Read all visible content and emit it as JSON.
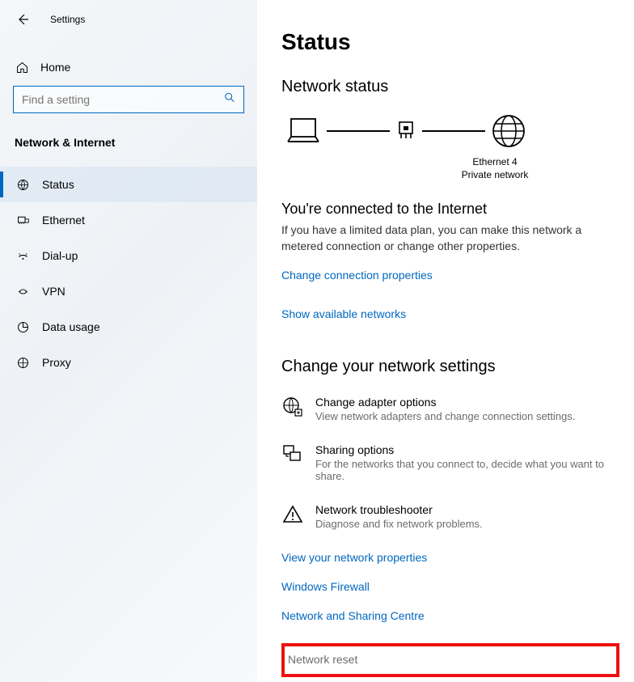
{
  "app": {
    "title": "Settings"
  },
  "home": {
    "label": "Home"
  },
  "search": {
    "placeholder": "Find a setting"
  },
  "category": {
    "title": "Network & Internet"
  },
  "nav": {
    "items": [
      {
        "label": "Status",
        "selected": true
      },
      {
        "label": "Ethernet",
        "selected": false
      },
      {
        "label": "Dial-up",
        "selected": false
      },
      {
        "label": "VPN",
        "selected": false
      },
      {
        "label": "Data usage",
        "selected": false
      },
      {
        "label": "Proxy",
        "selected": false
      }
    ]
  },
  "main": {
    "title": "Status",
    "network_status_heading": "Network status",
    "diagram": {
      "adapter_name": "Ethernet 4",
      "profile": "Private network"
    },
    "connected_title": "You're connected to the Internet",
    "connected_body": "If you have a limited data plan, you can make this network a metered connection or change other properties.",
    "link_change_conn": "Change connection properties",
    "link_show_avail": "Show available networks",
    "change_section_title": "Change your network settings",
    "options": [
      {
        "title": "Change adapter options",
        "desc": "View network adapters and change connection settings."
      },
      {
        "title": "Sharing options",
        "desc": "For the networks that you connect to, decide what you want to share."
      },
      {
        "title": "Network troubleshooter",
        "desc": "Diagnose and fix network problems."
      }
    ],
    "links": {
      "view_props": "View your network properties",
      "firewall": "Windows Firewall",
      "sharing": "Network and Sharing Centre",
      "reset": "Network reset"
    }
  }
}
